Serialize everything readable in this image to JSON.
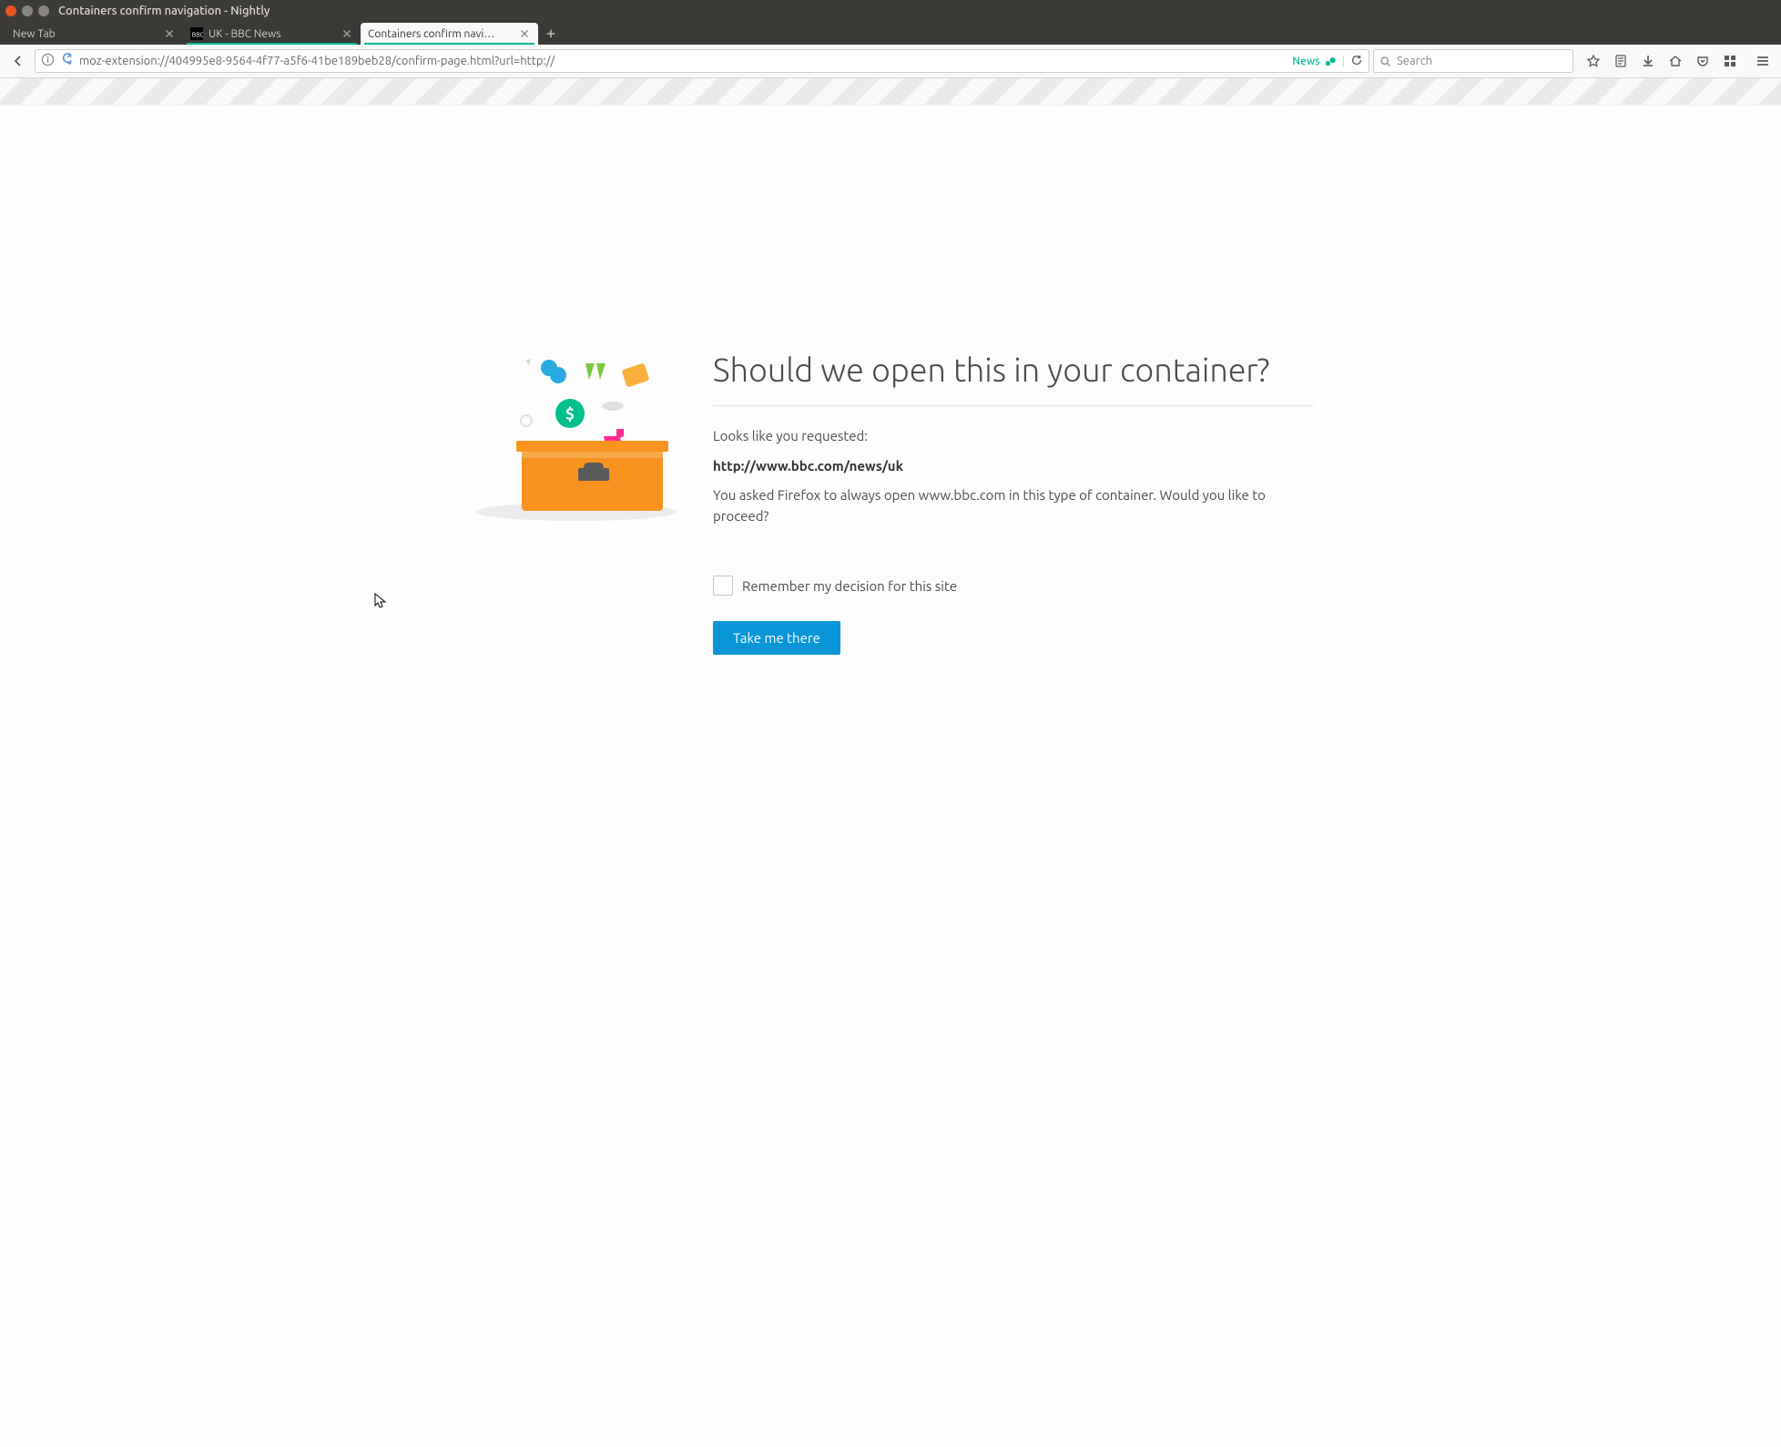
{
  "window": {
    "title": "Containers confirm navigation - Nightly"
  },
  "tabs": [
    {
      "label": "New Tab",
      "active": false,
      "underline": ""
    },
    {
      "label": "UK - BBC News",
      "active": false,
      "underline": "#00b894"
    },
    {
      "label": "Containers confirm navi…",
      "active": true,
      "underline": "#00b894"
    }
  ],
  "urlbar": {
    "url": "moz-extension://404995e8-9564-4f77-a5f6-41be189beb28/confirm-page.html?url=http://",
    "container_label": "News"
  },
  "searchbar": {
    "placeholder": "Search"
  },
  "page": {
    "heading": "Should we open this in your container?",
    "line1": "Looks like you requested:",
    "requested_url": "http://www.bbc.com/news/uk",
    "line2": "You asked Firefox to always open www.bbc.com in this type of container. Would you like to proceed?",
    "remember_label": "Remember my decision for this site",
    "button_label": "Take me there"
  }
}
